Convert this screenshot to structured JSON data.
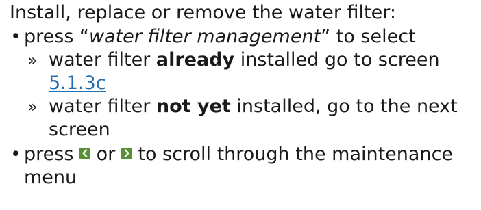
{
  "intro": "Install, replace or remove the water filter:",
  "bullet1": {
    "marker": "•",
    "prefix": "press “",
    "italic": "water filter management",
    "suffix": "” to select"
  },
  "sub1": {
    "marker": "»",
    "prefix": "water filter ",
    "bold": "already",
    "suffix": " installed go to screen ",
    "link": "5.1.3c"
  },
  "sub2": {
    "marker": "»",
    "prefix": "water filter ",
    "bold": "not yet",
    "suffix": " installed, go to the next screen"
  },
  "bullet2": {
    "marker": "•",
    "prefix": "press ",
    "left_icon": "chevron-left-icon",
    "middle": " or ",
    "right_icon": "chevron-right-icon",
    "suffix": " to scroll through the maintenance menu"
  },
  "colors": {
    "text": "#1a1a1a",
    "link": "#1f6fb2",
    "button": "#5b8f35"
  }
}
